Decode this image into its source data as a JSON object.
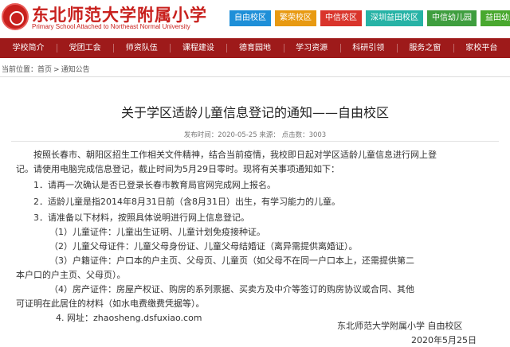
{
  "header": {
    "logo_cn": "东北师范大学附属小学",
    "logo_en": "Primary School Attached to Northeast Normal University",
    "campus_tabs": [
      {
        "label": "自由校区",
        "color": "#1e8fd8"
      },
      {
        "label": "繁荣校区",
        "color": "#e89a12"
      },
      {
        "label": "中信校区",
        "color": "#d9342b"
      },
      {
        "label": "深圳益田校区",
        "color": "#27b3a6"
      },
      {
        "label": "中信幼儿园",
        "color": "#3f9e3f"
      },
      {
        "label": "益田幼儿园",
        "color": "#49a82f"
      }
    ]
  },
  "nav": {
    "items": [
      "学校简介",
      "党团工会",
      "师资队伍",
      "课程建设",
      "德育园地",
      "学习资源",
      "科研引领",
      "服务之窗",
      "家校平台"
    ],
    "color": "#9e1a1a"
  },
  "breadcrumb": {
    "prefix": "当前位置：",
    "home": "首页",
    "sep": ">",
    "current": "通知公告"
  },
  "article": {
    "title": "关于学区适龄儿童信息登记的通知——自由校区",
    "meta": "发布时间：2020-05-25  来源：  点击数：3003",
    "paragraphs": {
      "intro_1": "按照长春市、朝阳区招生工作相关文件精神，结合当前疫情，我校即日起对学区适龄儿童信息进行网上登",
      "intro_2": "记。请使用电脑完成信息登记，截止时间为5月29日零时。现将有关事项通知如下：",
      "item_1": "1．请再一次确认是否已登录长春市教育局官网完成网上报名。",
      "item_2": "2．适龄儿童是指2014年8月31日前（含8月31日）出生，有学习能力的儿童。",
      "item_3": "3．请准备以下材料，按照具体说明进行网上信息登记。",
      "sub_1": "（1）儿童证件：儿童出生证明、儿童计划免疫接种证。",
      "sub_2": "（2）儿童父母证件：儿童父母身份证、儿童父母结婚证（离异需提供离婚证）。",
      "sub_3a": "（3）户籍证件：户口本的户主页、父母页、儿童页（如父母不在同一户口本上，还需提供第二",
      "sub_3b": "本户口的户主页、父母页）。",
      "sub_4a": "（4）房产证件：房屋产权证、购房的系列票据、买卖方及中介等签订的购房协议或合同、其他",
      "sub_4b": "可证明在此居住的材料（如水电费缴费凭据等）。",
      "item_4": "4. 网址：zhaosheng.dsfuxiao.com"
    },
    "signature": {
      "org": "东北师范大学附属小学 自由校区",
      "date": "2020年5月25日"
    }
  }
}
